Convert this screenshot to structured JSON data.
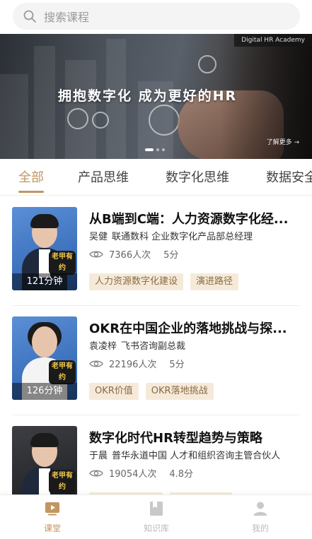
{
  "search": {
    "placeholder": "搜索课程"
  },
  "banner": {
    "tag": "Digital HR Academy",
    "title": "拥抱数字化  成为更好的HR",
    "more": "了解更多 →"
  },
  "tabs": [
    {
      "label": "全部",
      "active": true
    },
    {
      "label": "产品思维"
    },
    {
      "label": "数字化思维"
    },
    {
      "label": "数据安全"
    }
  ],
  "courses": [
    {
      "title": "从B端到C端：人力资源数字化经...",
      "author": "吴健",
      "role": "联通数科 企业数字化产品部总经理",
      "views": "7366人次",
      "score": "5分",
      "duration": "121分钟",
      "tags": [
        "人力资源数字化建设",
        "演进路径"
      ],
      "logo": "老甲有约"
    },
    {
      "title": "OKR在中国企业的落地挑战与探...",
      "author": "袁凌梓",
      "role": "飞书咨询副总裁",
      "views": "22196人次",
      "score": "5分",
      "duration": "126分钟",
      "tags": [
        "OKR价值",
        "OKR落地挑战"
      ],
      "logo": "老甲有约"
    },
    {
      "title": "数字化时代HR转型趋势与策略",
      "author": "于晨",
      "role": "普华永道中国 人才和组织咨询主管合伙人",
      "views": "19054人次",
      "score": "4.8分",
      "duration": "",
      "tags": [
        "",
        ""
      ],
      "logo": "老甲有约"
    }
  ],
  "bottom_nav": [
    {
      "label": "课堂",
      "icon": "classroom-icon",
      "active": true
    },
    {
      "label": "知识库",
      "icon": "knowledge-base-icon"
    },
    {
      "label": "我的",
      "icon": "profile-icon"
    }
  ],
  "colors": {
    "accent": "#c19660",
    "tag_bg": "#f5ead9",
    "tag_text": "#8a6a44"
  }
}
